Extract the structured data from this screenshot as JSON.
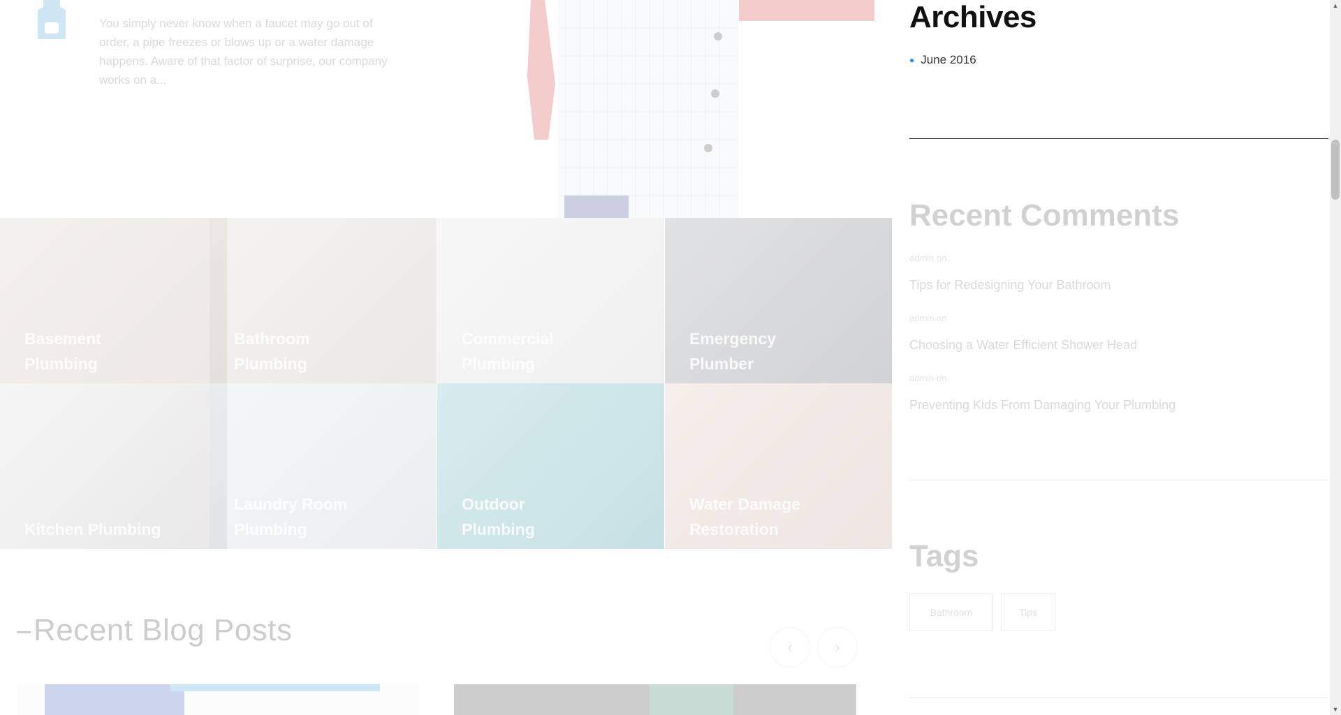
{
  "intro": {
    "icon": "bucket-icon",
    "text": "You simply never know when a faucet may go out of order, a pipe freezes or blows up or a water damage happens. Aware of that factor of surprise, our company works on a..."
  },
  "services": [
    {
      "title": "Basement Plumbing"
    },
    {
      "title": "Bathroom Plumbing"
    },
    {
      "title": "Commercial Plumbing"
    },
    {
      "title": "Emergency Plumber"
    },
    {
      "title": "Kitchen Plumbing"
    },
    {
      "title": "Laundry Room Plumbing"
    },
    {
      "title": "Outdoor Plumbing"
    },
    {
      "title": "Water Damage Restoration"
    }
  ],
  "blog": {
    "heading": "Recent Blog Posts",
    "prev_icon": "chevron-left-icon",
    "next_icon": "chevron-right-icon"
  },
  "sidebar": {
    "archives": {
      "title": "Archives",
      "items": [
        "June 2016"
      ]
    },
    "recent_comments": {
      "title": "Recent Comments",
      "items": [
        {
          "meta": "admin on",
          "link": "Tips for Redesigning Your Bathroom"
        },
        {
          "meta": "admin on",
          "link": "Choosing a Water Efficient Shower Head"
        },
        {
          "meta": "admin on",
          "link": "Preventing Kids From Damaging Your Plumbing"
        }
      ]
    },
    "tags": {
      "title": "Tags",
      "items": [
        "Bathroom",
        "Tips"
      ]
    }
  },
  "colors": {
    "accent": "#2a8fd6"
  }
}
